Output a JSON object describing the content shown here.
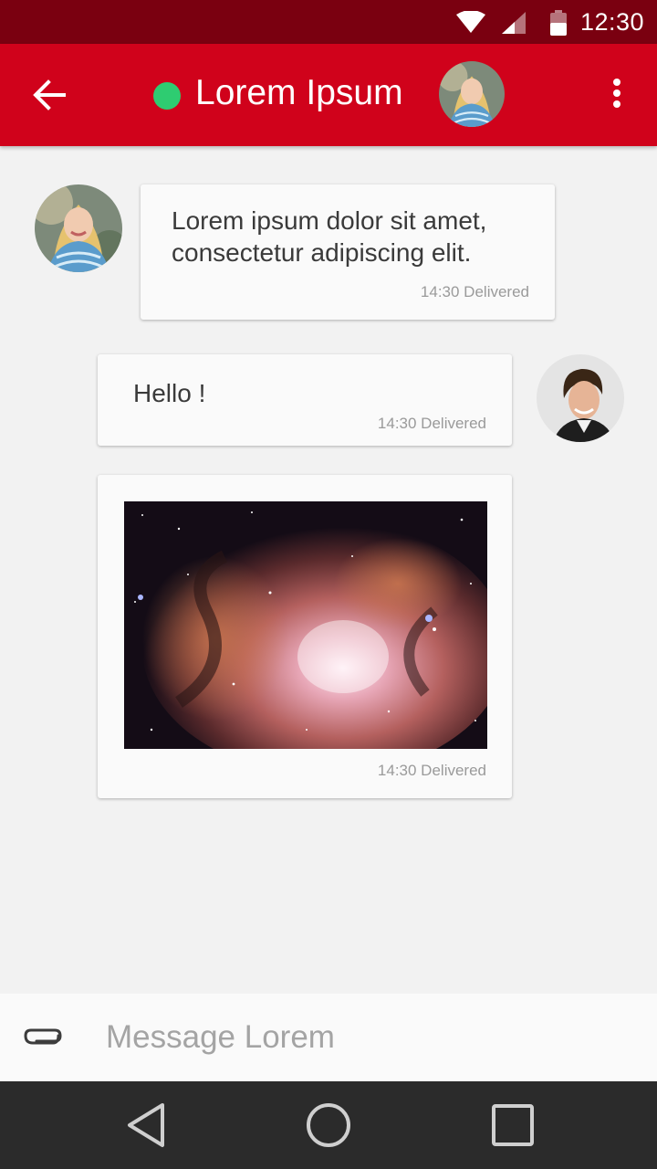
{
  "status_bar": {
    "time": "12:30",
    "icons": [
      "wifi-icon",
      "cellular-signal-icon",
      "battery-icon"
    ]
  },
  "header": {
    "title": "Lorem Ipsum",
    "presence": "online",
    "presence_color": "#2ecc71",
    "back_icon": "arrow-left-icon",
    "menu_icon": "more-vertical-icon",
    "bar_color": "#d0021b",
    "status_color": "#7a0010"
  },
  "messages": [
    {
      "direction": "incoming",
      "text": "Lorem ipsum dolor sit amet, consectetur adipiscing elit.",
      "meta": "14:30 Delivered"
    },
    {
      "direction": "outgoing",
      "text": "Hello !",
      "meta": "14:30 Delivered"
    },
    {
      "direction": "outgoing",
      "type": "image",
      "meta": "14:30 Delivered"
    }
  ],
  "composer": {
    "placeholder": "Message Lorem",
    "attach_icon": "paperclip-icon"
  },
  "nav_bar": {
    "icons": [
      "nav-back-icon",
      "nav-home-icon",
      "nav-recents-icon"
    ]
  }
}
